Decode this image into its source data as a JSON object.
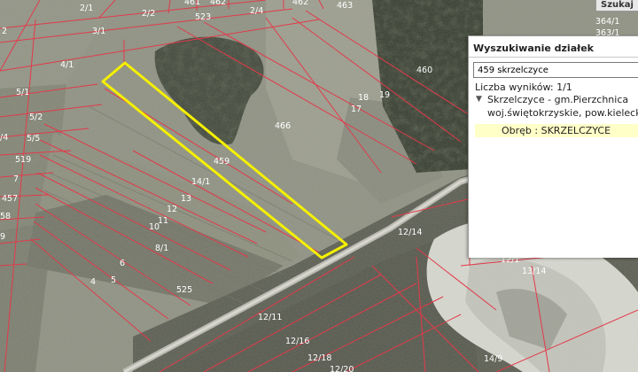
{
  "search_panel": {
    "title": "Wyszukiwanie działek",
    "query": "459 skrzelczyce",
    "result_count": "Liczba wyników: 1/1",
    "result_line1": "Skrzelczyce - gm.Pierzchnica",
    "result_line2": "woj.świętokrzyskie, pow.kielecki",
    "obreb": "Obręb : SKRZELCZYCE",
    "expand_icon": "triangle-down"
  },
  "search_tab_label": "Szukaj",
  "highlight_color": "#f5f000",
  "parcel_line_color": "#e23a4a",
  "parcel_labels": [
    "2/1",
    "2/2",
    "461",
    "462",
    "523",
    "2/4",
    "462",
    "463",
    "3/1",
    "2",
    "4/1",
    "460",
    "19",
    "18",
    "17",
    "5/1",
    "5/2",
    "466",
    "/4",
    "5/5",
    "519",
    "459",
    "14/1",
    "7",
    "13",
    "457",
    "12",
    "58",
    "11",
    "10",
    "9",
    "8/1",
    "12/14",
    "6",
    "5",
    "4",
    "525",
    "13/14",
    "12/11",
    "12/16",
    "12/18",
    "12/20",
    "14/9",
    "364/1",
    "363/1",
    "12/1"
  ]
}
